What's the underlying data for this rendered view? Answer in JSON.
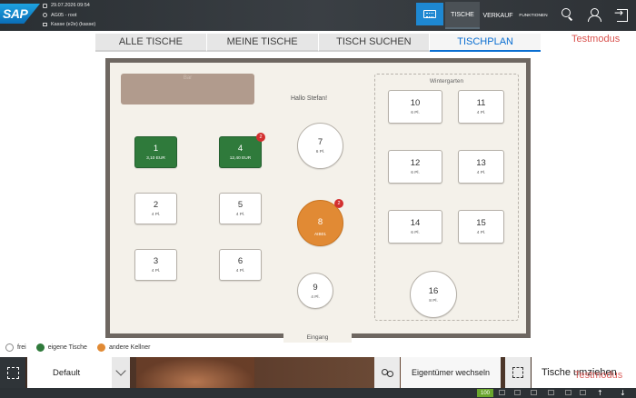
{
  "header": {
    "logo": "SAP",
    "date": "29.07.2026 09:54",
    "user": "AG05 - root",
    "kasse": "Kasse (e2e) (kasse)",
    "nav": {
      "tische": "TISCHE",
      "verkauf": "VERKAUF",
      "funktionen": "FUNKTIONEN"
    },
    "icons": [
      "keyboard-icon",
      "search-icon",
      "user-icon",
      "logout-icon"
    ]
  },
  "tabs": [
    {
      "label": "ALLE TISCHE",
      "active": false
    },
    {
      "label": "MEINE TISCHE",
      "active": false
    },
    {
      "label": "TISCH SUCHEN",
      "active": false
    },
    {
      "label": "TISCHPLAN",
      "active": true
    }
  ],
  "testmodus": "Testmodus",
  "plan": {
    "bar": "Bar",
    "greeting": "Hallo Stefan!",
    "wintergarten": "Wintergarten",
    "eingang": "Eingang"
  },
  "tables": {
    "t1": {
      "num": "1",
      "sub": "3,10 EUR",
      "status": "eigene"
    },
    "t4": {
      "num": "4",
      "sub": "12,40 EUR",
      "status": "eigene",
      "badge": "2"
    },
    "t7": {
      "num": "7",
      "sub": "6 Pl.",
      "status": "frei"
    },
    "t2": {
      "num": "2",
      "sub": "4 Pl.",
      "status": "frei"
    },
    "t5": {
      "num": "5",
      "sub": "4 Pl.",
      "status": "frei"
    },
    "t8": {
      "num": "8",
      "sub": "AIB01",
      "status": "andere",
      "badge": "2"
    },
    "t3": {
      "num": "3",
      "sub": "4 Pl.",
      "status": "frei"
    },
    "t6": {
      "num": "6",
      "sub": "4 Pl.",
      "status": "frei"
    },
    "t9": {
      "num": "9",
      "sub": "4 Pl.",
      "status": "frei"
    },
    "t10": {
      "num": "10",
      "sub": "6 Pl.",
      "status": "frei"
    },
    "t11": {
      "num": "11",
      "sub": "4 Pl.",
      "status": "frei"
    },
    "t12": {
      "num": "12",
      "sub": "6 Pl.",
      "status": "frei"
    },
    "t13": {
      "num": "13",
      "sub": "4 Pl.",
      "status": "frei"
    },
    "t14": {
      "num": "14",
      "sub": "6 Pl.",
      "status": "frei"
    },
    "t15": {
      "num": "15",
      "sub": "4 Pl.",
      "status": "frei"
    },
    "t16": {
      "num": "16",
      "sub": "8 Pl.",
      "status": "frei"
    }
  },
  "legend": {
    "frei": "frei",
    "eigene": "eigene Tische",
    "andere": "andere Kellner"
  },
  "colors": {
    "eigene": "#2f7a3b",
    "andere": "#e18a34",
    "accent": "#0a6ed1",
    "badge": "#d32f2f",
    "testmodus": "#d9534f"
  },
  "bottom": {
    "layout_select": "Default",
    "owner_button": "Eigentümer wechseln",
    "move_button": "Tische umziehen"
  },
  "statusbar": {
    "count": "100"
  }
}
